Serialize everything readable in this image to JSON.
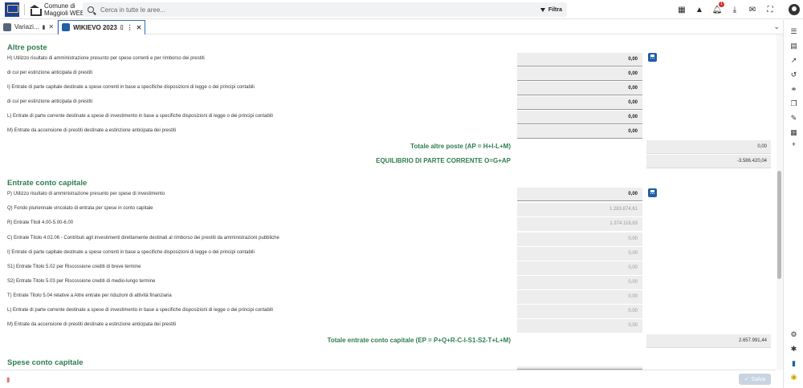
{
  "app": {
    "brand": "Comune di Maggioli WEB",
    "search_placeholder": "Cerca in tutte le aree...",
    "filter_label": "Filtra",
    "notification_count": "1"
  },
  "tabs": [
    {
      "label": "Variazi...",
      "active": false
    },
    {
      "label": "WIKIEVO 2023",
      "active": true
    }
  ],
  "sections": {
    "altre_poste": {
      "title": "Altre poste",
      "rows": [
        {
          "label": "H) Utilizzo risultato di amministrazione presunto per spese correnti e per rimborso dei prestiti",
          "value": "0,00"
        },
        {
          "label": "di cui per estinzione anticipata di prestiti",
          "value": "0,00"
        },
        {
          "label": "I) Entrate di parte capitale destinate a spese correnti in base a specifiche disposizioni di legge o dei principi contabili",
          "value": "0,00"
        },
        {
          "label": "di cui per estinzione anticipata di prestiti",
          "value": "0,00"
        },
        {
          "label": "L) Entrate di parte corrente destinate a spese di investimento in base a specifiche disposizioni di legge o dei principi contabili",
          "value": "0,00"
        },
        {
          "label": "M) Entrate da accensione di prestiti destinate a estinzione anticipata dei prestiti",
          "value": "0,00"
        }
      ],
      "total_label": "Totale altre poste (AP = H+I-L+M)",
      "total_value": "0,00",
      "equilibrio_label": "EQUILIBRIO DI PARTE CORRENTE O=G+AP",
      "equilibrio_value": "-3.586.420,04"
    },
    "entrate_conto_capitale": {
      "title": "Entrate conto capitale",
      "rows": [
        {
          "label": "P) Utilizzo risultato di amministrazione presunto per spese di investimento",
          "value": "0,00"
        },
        {
          "label": "Q) Fondo pluriennale vincolato di entrata per spese in conto capitale",
          "value": "1.283.874,61"
        },
        {
          "label": "R) Entrate Titoli 4.00-5.00-6.00",
          "value": "1.374.116,83"
        },
        {
          "label": "C) Entrate Titolo 4.02.06 - Contributi agli investimenti direttamente destinati al rimborso dei prestiti da amministrazioni pubbliche",
          "value": "0,00"
        },
        {
          "label": "I) Entrate di parte capitale destinate a spese correnti in base a specifiche disposizioni di legge o dei principi contabili",
          "value": "0,00"
        },
        {
          "label": "S1) Entrate Titolo 5.02 per Riscossione crediti di breve termine",
          "value": "0,00"
        },
        {
          "label": "S2) Entrate Titolo 5.03 per Riscossione crediti di medio-lungo termine",
          "value": "0,00"
        },
        {
          "label": "T) Entrate Titolo 5.04 relative a Altre entrate per riduzioni di attività finanziaria",
          "value": "0,00"
        },
        {
          "label": "L) Entrate di parte corrente destinate a spese di investimento in base a specifiche disposizioni di legge o dei principi contabili",
          "value": "0,00"
        },
        {
          "label": "M) Entrate da accensione di prestiti destinate a estinzione anticipata dei prestiti",
          "value": "0,00"
        }
      ],
      "total_label": "Totale entrate conto capitale (EP = P+Q+R-C-I-S1-S2-T+L+M)",
      "total_value": "2.657.991,44"
    },
    "spese_conto_capitale": {
      "title": "Spese conto capitale"
    }
  },
  "footer": {
    "save_label": "Salva"
  },
  "colors": {
    "section_green": "#2e7d4f",
    "accent_blue": "#1f5fa8",
    "cell_gray": "#ededed"
  }
}
